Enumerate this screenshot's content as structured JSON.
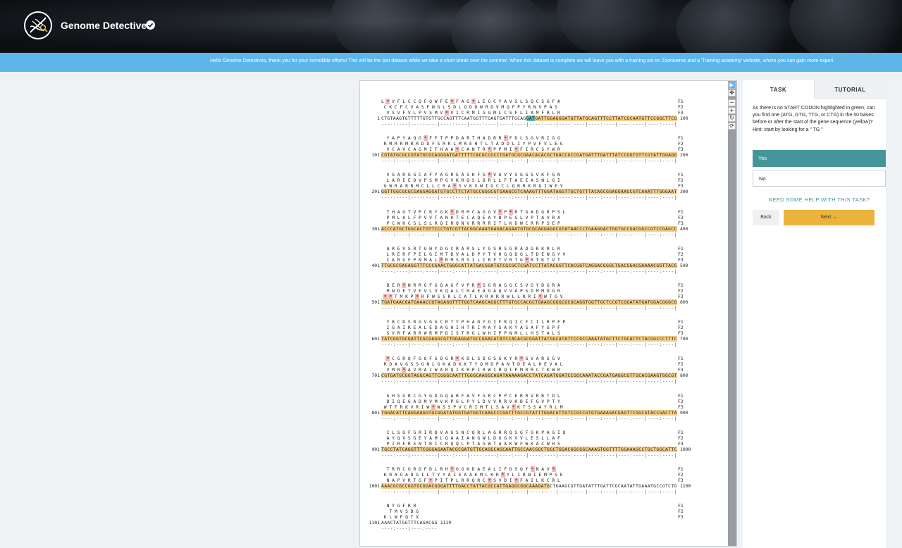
{
  "header": {
    "brand": "Genome Detectives"
  },
  "banner": {
    "text": "Hello Genome Detectives, thank you for your incredible efforts! This will be the last dataset while we take a short break over the summer. When this dataset is complete we will leave you with a training set on Zooniverse and a 'Training academy' website, where you can gain more experi"
  },
  "viewer": {
    "blocks": [
      {
        "F1": "L * V F L C C Q F Q W F E * F A G * L E G C Y A V S L S Q C S G F A",
        "F2": " C K C F C V A S F N G L S D L Q D D W R D V M Q F P Y R N V P A S ",
        "F3": "  V S V F V L P V S M V * V I C R M I G G M L C S F L I A M F R L R",
        "start": "1",
        "end": "100",
        "dna": "CTGTAAGTGTTTTTGTGTTGCCAGTTTCAATGGTTTGAGTGATTTGCAGGATGATTGGAGGGATGTTATGCAGTTTCCTTATCGCAATGTTCCGGCTTCG"
      },
      {
        "F1": "  Y A P Y A Q G * F F T P P D A R T H A D R R * F D L S G V R I G G",
        "F2": " R M R R M R R D D F S R R L M R E H T L T A D D L I Y P V F V L E G",
        "F3": "  V C A V C A G M I F H A A * C A N T R * P P M I * F I R C S Y W R",
        "start": "101",
        "end": "200",
        "dna": "CGTATGCGCCGTATGCGCAGGGATGATTTTTCACGCCGCCTGATGCGCGAACACACGCTGACCGCCGATGATTTGATTTATCCGGTGTTCGTATTGGAGG"
      },
      {
        "F1": "  V G A R G G C A F Y A G R E A S K F G * V A V Y S G G S V K F G N",
        "F2": "  L A R E E D V P S M P G V K R Q S L D R L L F T A E E A S N L G I",
        "F3": " G W R A R R M C L L C R A * S V K V W I G C C L Q R R K R Q I W E Y",
        "start": "201",
        "end": "300",
        "dna": "GGTTGGCGCGCGAGGAGGATGTGCCTTCTATGCCGGGCGTGAAGCGTCAAAGTTTGGATAGGTTGCTGTTTACAGCGGAGGAAGCGTCAAATTTGGGAAT"
      },
      {
        "F1": "  T H A G T V P C R Y G K * D R M C A G G V * P * R T G A D G R P S L",
        "F2": "  P M L A L F P V V T A N K T E C A Q E A Y N P E G L V P T A V R A",
        "F3": "  P C W H C S L S L R Q I R Q N V R R R R I T L K D W C R R P S E P",
        "start": "301",
        "end": "400",
        "dna": "ACCCATGCTGGCACTGTTCCCTGTCGTTACGGCAAATAAGACAGAATGTGCGCAGGAGGCGTATAACCCTGAAGGACTGGTGCCGACGGCCGTCCGAGCC"
      },
      {
        "F1": "  A R E V S R T G H Y D G C R A R S L Y G S R S G R A D G R K R L R",
        "F2": "  L R E R F P E L G I M T D V A L D P Y T V H G Q D G L T D E N G Y V",
        "F3": "  C A R G F P N M A L * R M S R S I L I R F T V R T G * R T K T V T",
        "start": "401",
        "end": "500",
        "dna": "TTGCGCGAGAGGTTTCCCGAACTGGGCATTATGACGGATGTCGCGCTCGATCCTTATACGGTTCACGGTCAGGACGGGCTGACGGACGAAAACGGTTACG"
      },
      {
        "F1": "  D E R * N R R G F G Q A G F V P R * S G R A G G C S V G Y D G R A",
        "F2": "  M N D E T V E V L V K Q A L C H A E A G A Q V V A P S D M M D G R",
        "F3": " * * T M K P * R F W S S R L C A T L K R A R R W L L R R I * W T G V",
        "start": "501",
        "end": "600",
        "dna": "TGATGAACGATGAAACCGTAGAGGTTTTGGTCAAGCAGGCTTTGTGCCACGCTGAAGCGGGCGCGCAGGTGGTTGCTCCGTCGGATATGATGGACGGGCG"
      },
      {
        "F1": "  Y R C D S R G V G G C R T Y P H A D Y G I F R Q I C F C I L R P F P",
        "F2": "  I G A I R E A L E D A G H I H T R I M A Y S A K Y A S A F Y G P F",
        "F3": "  S V R F A R R W R M P D I S T R G L W H I P P N M L L H S T A L S",
        "start": "601",
        "end": "700",
        "dna": "TATCGGTGCGATTCGCGAGGCGTTGGAGGATGCCGGACATATCCACACGCGGATTATGGCATATTCCGCCAAATATGCTTCTGCATTCTACGGCCCTTTC"
      },
      {
        "F1": "  * C G R Q F G Q F G Q G R * K D L S D G S G K Y R * G V A R S G V",
        "F2": " R D A V G S S G N L G K A D K K T Y Q M D P A N T D E A L H E V A L",
        "F3": "  V M R * A V R A I W A R Q I K R P I R W I R Q I P M R R C T K W R",
        "start": "701",
        "end": "800",
        "dna": "CGTGATGCGGTAGGCAGTTCGGGCAATTTGGGCAAGGCAGATAAAAAGACCTATCAGATGGATCCGGCAAATACCGATGAGGCGTTGCACGAAGTGGCGT"
      },
      {
        "F1": "  G H S G R C G Y G D G Q A R F A V F G R C P P C E R R V R R T D L",
        "F2": "  D I Q E G A D M V M V K P G L P Y L D V V R R V K D E F G V P T Y",
        "F3": " W T F R K V R I W * W S S P V C R I M T L S A V * K T S S A Y R L M",
        "start": "801",
        "end": "900",
        "dna": "TGGACATTCAGGAAGGTGCGGATATGGTGATGGTCAAGCCCGGTTTGCCGTATTTGGACGTTGTCCGCCGTGTGAAAGACGAGTTCGGCGTACCGACTTA"
      },
      {
        "F1": "  C L S G F G R I R D V A G S N C Q R L A G R R Q S G F G K P A G I Q",
        "F2": "  A Y Q V S G E Y A M L Q A A I A N G W L D G G K V V L E S L L A F",
        "F3": "  P I R F R E N T R C C R Q Q L P T A G W T A A K W F W K A C W H S",
        "start": "901",
        "end": "1000",
        "dna": "TGCCTATCAGGTTTCGGGAGAATACGCGATGTTGCAGGCAGCAATTGCCAACGGCTGGCTGGACGGCGGCAAAGTGGTTTTGGAAAGCCTGCTGGCATTC"
      },
      {
        "F1": "  T R R C G R D F D L R H * G G K D A E A L I F D S Q Y * N A V *",
        "F2": " K R A G A D G I L T Y Y A I E A A K M L K R * Y L I R N I E M P S E",
        "F3": "  N A P V R T G F * P I T P L R R Q R C * S V D I * F A I L K C R L",
        "start": "1001",
        "end": "1100",
        "dna": "AAACGCGCCGGTGCGGACGGGATTTTGACCTATTACGCCATTGAGGCGGCAAAGATGCTGAAGCGTTGATATTTGATTCGCAATATTGAAATGCCGTCTG"
      },
      {
        "F1": "  N Y G F R R",
        "F2": "   T M V S D G",
        "F3": " K L W F Q T X",
        "start": "1101",
        "end": "1119",
        "dna": "AAACTATGGTTTCAGACGG"
      }
    ]
  },
  "panel": {
    "tabs": [
      "TASK",
      "TUTORIAL"
    ],
    "question": "As there is no START CODON highlighted in green, can you find one (ATG, GTG, TTG, or CTG) in the 50 bases before or after the start of the gene sequence (yellow)?",
    "hint": "Hint: start by looking for a \" TG \"",
    "answers": [
      "Yes",
      "No"
    ],
    "help": "NEED SOME HELP WITH THIS TASK?",
    "back": "Back",
    "next": "Next →"
  },
  "toolbar": {
    "labels": [
      "F1",
      "F2",
      "F3"
    ]
  }
}
